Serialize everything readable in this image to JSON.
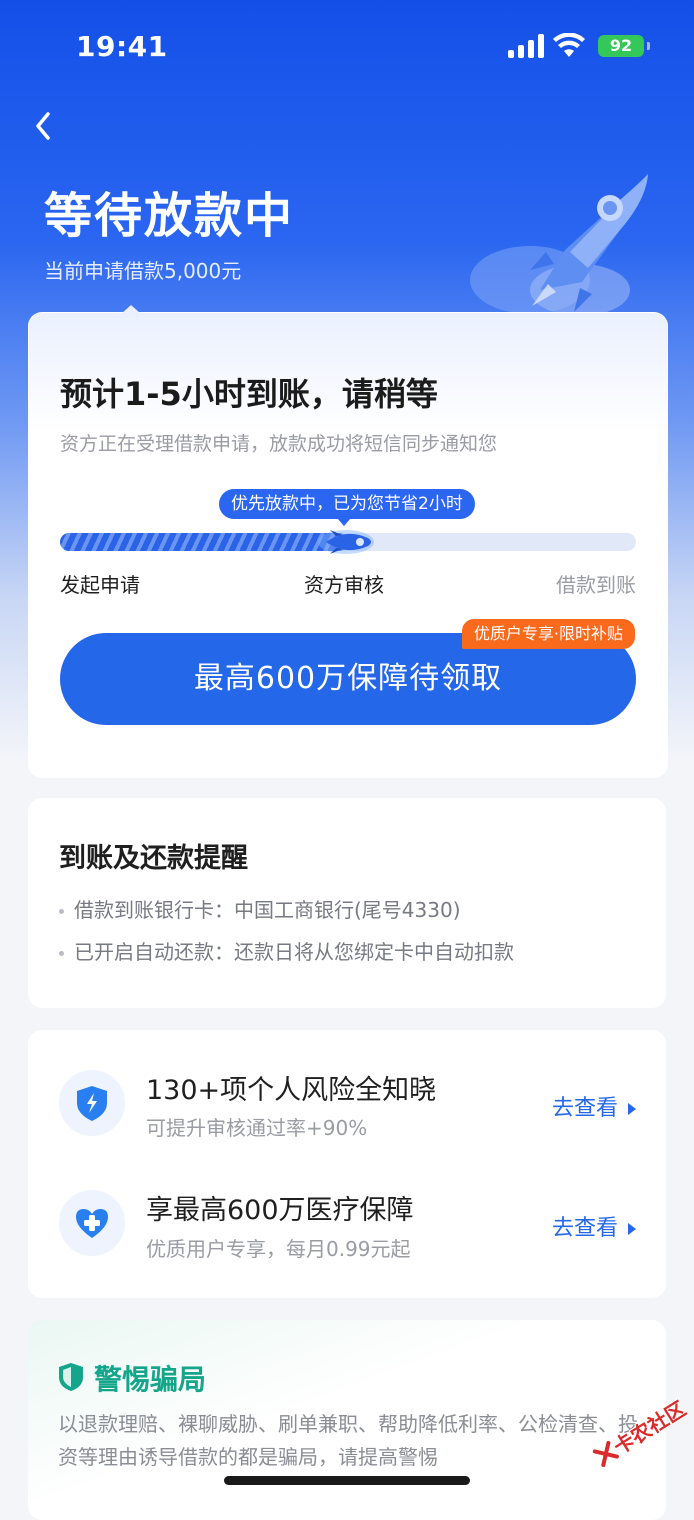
{
  "status_bar": {
    "time": "19:41",
    "battery": "92"
  },
  "header": {
    "back_icon": "chevron-left-icon",
    "title": "等待放款中",
    "subtitle": "当前申请借款5,000元"
  },
  "progress_card": {
    "eta_title": "预计1-5小时到账，请稍等",
    "eta_desc": "资方正在受理借款申请，放款成功将短信同步通知您",
    "pill_text": "优先放款中，已为您节省2小时",
    "progress_fraction": 0.5,
    "steps": [
      "发起申请",
      "资方审核",
      "借款到账"
    ],
    "cta_label": "最高600万保障待领取",
    "cta_tag": "优质户专享·限时补贴"
  },
  "reminder_card": {
    "title": "到账及还款提醒",
    "lines": [
      "借款到账银行卡：中国工商银行(尾号4330)",
      "已开启自动还款：还款日将从您绑定卡中自动扣款"
    ]
  },
  "services": [
    {
      "icon": "shield-lightning-icon",
      "title": "130+项个人风险全知晓",
      "desc": "可提升审核通过率+90%",
      "link": "去查看"
    },
    {
      "icon": "heart-plus-icon",
      "title": "享最高600万医疗保障",
      "desc": "优质用户专享，每月0.99元起",
      "link": "去查看"
    }
  ],
  "warning_card": {
    "title": "警惕骗局",
    "text": "以退款理赔、裸聊威胁、刷单兼职、帮助降低利率、公检清查、投资等理由诱导借款的都是骗局，请提高警惕"
  },
  "watermark": {
    "text": "卡农社区"
  },
  "colors": {
    "primary": "#2467e8",
    "accent_orange": "#fa6a1d",
    "warning_green": "#14a58a"
  }
}
